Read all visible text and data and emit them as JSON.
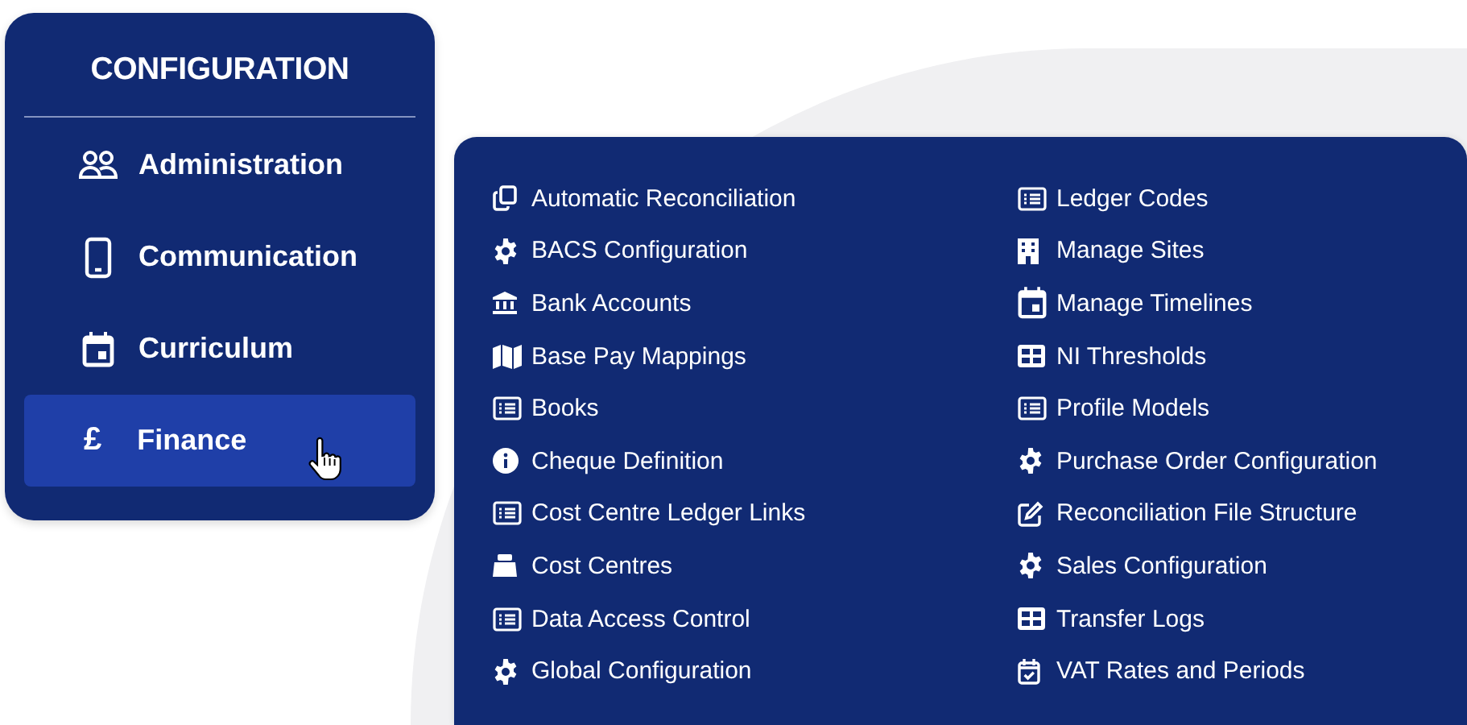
{
  "sidebar": {
    "title": "CONFIGURATION",
    "items": [
      {
        "label": "Administration",
        "kind": "people",
        "selected": false
      },
      {
        "label": "Communication",
        "kind": "phone",
        "selected": false
      },
      {
        "label": "Curriculum",
        "kind": "calendar",
        "selected": false
      },
      {
        "label": "Finance",
        "kind": "glyph",
        "glyph": "£",
        "selected": true
      }
    ]
  },
  "submenu": {
    "columns": [
      [
        {
          "label": "Automatic Reconciliation",
          "kind": "copy"
        },
        {
          "label": "BACS Configuration",
          "kind": "gear"
        },
        {
          "label": "Bank Accounts",
          "kind": "bank"
        },
        {
          "label": "Base Pay Mappings",
          "kind": "map"
        },
        {
          "label": "Books",
          "kind": "list"
        },
        {
          "label": "Cheque Definition",
          "kind": "info"
        },
        {
          "label": "Cost Centre Ledger Links",
          "kind": "list"
        },
        {
          "label": "Cost Centres",
          "kind": "register"
        },
        {
          "label": "Data Access Control",
          "kind": "list"
        },
        {
          "label": "Global Configuration",
          "kind": "gear"
        }
      ],
      [
        {
          "label": "Ledger Codes",
          "kind": "list"
        },
        {
          "label": "Manage Sites",
          "kind": "building"
        },
        {
          "label": "Manage Timelines",
          "kind": "calendar"
        },
        {
          "label": "NI Thresholds",
          "kind": "grid"
        },
        {
          "label": "Profile Models",
          "kind": "list"
        },
        {
          "label": "Purchase Order Configuration",
          "kind": "gear"
        },
        {
          "label": "Reconciliation File Structure",
          "kind": "edit"
        },
        {
          "label": "Sales Configuration",
          "kind": "gear"
        },
        {
          "label": "Transfer Logs",
          "kind": "grid"
        },
        {
          "label": "VAT Rates and Periods",
          "kind": "calendar-check"
        }
      ]
    ]
  }
}
